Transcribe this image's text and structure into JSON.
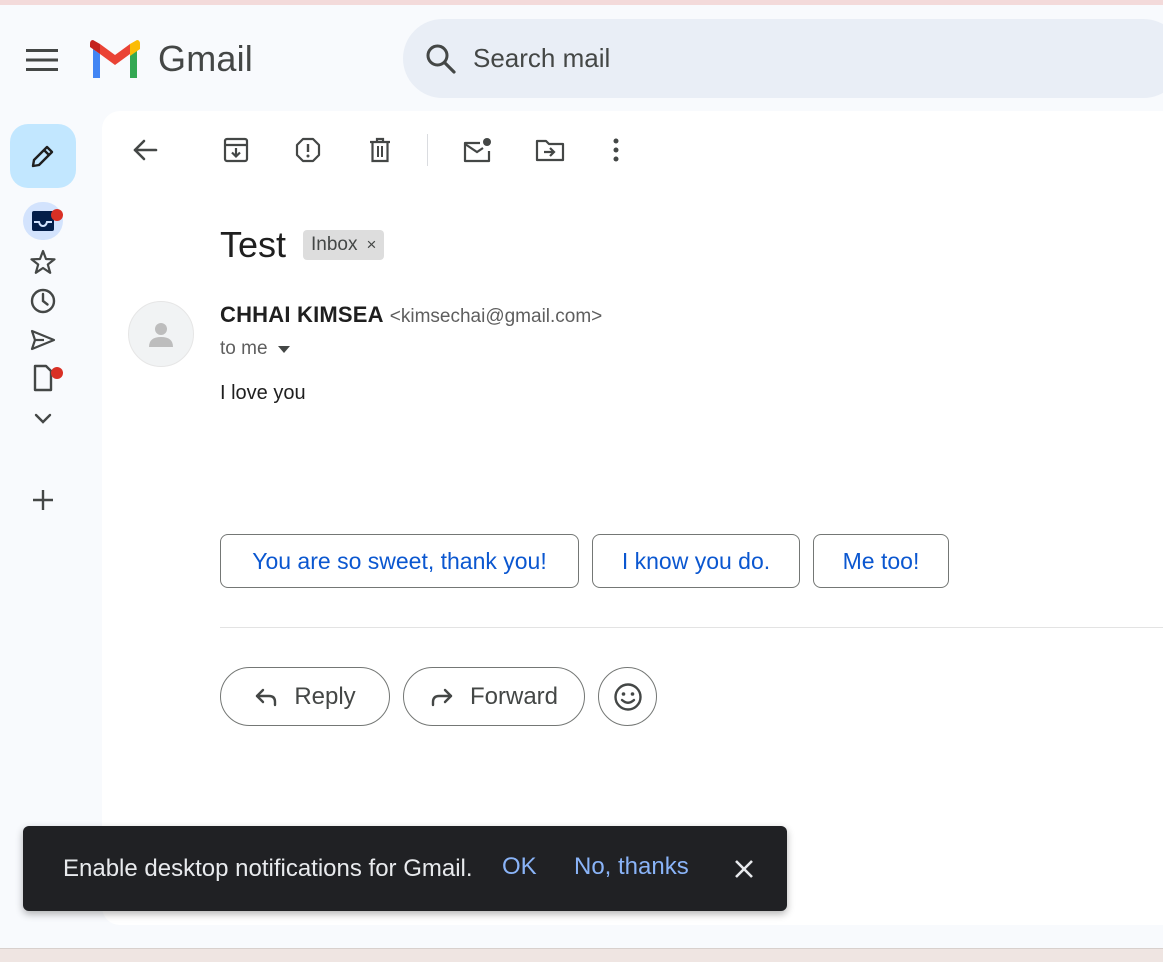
{
  "app": {
    "name": "Gmail"
  },
  "search": {
    "placeholder": "Search mail"
  },
  "toolbar": {
    "icons": [
      "back-arrow-icon",
      "archive-icon",
      "report-spam-icon",
      "delete-icon",
      "mark-unread-icon",
      "move-to-icon",
      "more-vert-icon"
    ]
  },
  "sidebar": {
    "items": [
      {
        "icon": "inbox-icon",
        "badge": true
      },
      {
        "icon": "star-icon",
        "badge": false
      },
      {
        "icon": "snoozed-clock-icon",
        "badge": false
      },
      {
        "icon": "sent-icon",
        "badge": false
      },
      {
        "icon": "drafts-icon",
        "badge": true
      },
      {
        "icon": "expand-more-icon",
        "badge": false
      },
      {
        "icon": "add-label-icon",
        "badge": false
      }
    ]
  },
  "message": {
    "subject": "Test",
    "label": "Inbox",
    "label_remove": "×",
    "sender_name": "CHHAI KIMSEA",
    "sender_email": "<kimsechai@gmail.com>",
    "recipient": "to me",
    "body": "I love you"
  },
  "smart_replies": [
    "You are so sweet, thank you!",
    "I know you do.",
    "Me too!"
  ],
  "actions": {
    "reply": "Reply",
    "forward": "Forward"
  },
  "snackbar": {
    "message": "Enable desktop notifications for Gmail.",
    "ok": "OK",
    "no_thanks": "No, thanks"
  },
  "colors": {
    "accent_blue": "#0b57d0",
    "compose_bg": "#c2e7ff",
    "search_bg": "#e9eef6",
    "badge_red": "#d93025",
    "snackbar_bg": "#202124",
    "snackbar_link": "#8ab4f8"
  }
}
